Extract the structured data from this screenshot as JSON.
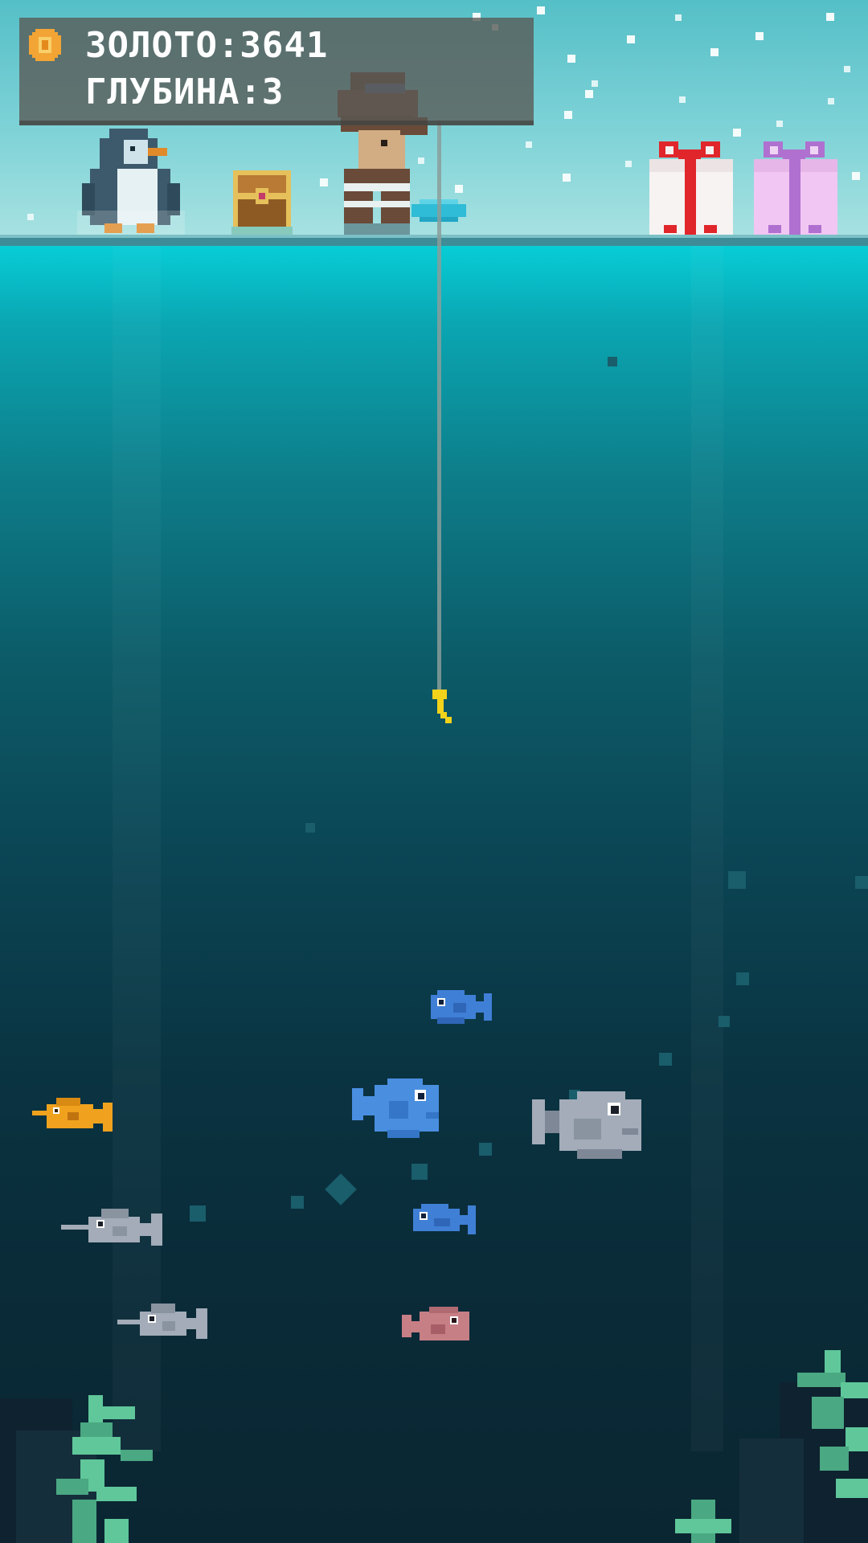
{
  "hud": {
    "gold_text": "ЗОЛОТО:3641",
    "depth_text": "ГЛУБИНА:3"
  },
  "colors": {
    "sky": "#7fd3d7",
    "water_top": "#07cdd6",
    "water_deep": "#0a2632",
    "hud_bg": "#585854",
    "hud_text": "#ffffff",
    "coin": "#f2a534",
    "hook": "#f3d21b",
    "gift_red_ribbon": "#e0262b",
    "gift_purple_ribbon": "#b070d0"
  },
  "scene": {
    "surface_items": [
      "penguin",
      "treasure-chest",
      "fisherman",
      "ice-hole",
      "gift-red",
      "gift-purple"
    ],
    "fish": [
      {
        "kind": "blue-fish",
        "color": "#3f7fd6"
      },
      {
        "kind": "golden-fish",
        "color": "#f0a21e"
      },
      {
        "kind": "big-blue-fish",
        "color": "#4a8ee0"
      },
      {
        "kind": "grey-fish",
        "color": "#a3acb8"
      },
      {
        "kind": "grey-swordfish",
        "color": "#a3acb8"
      },
      {
        "kind": "small-blue-fish",
        "color": "#3f7fd6"
      },
      {
        "kind": "grey-swordfish",
        "color": "#a3acb8"
      },
      {
        "kind": "pink-fish",
        "color": "#c77f86"
      }
    ],
    "seaweed_color": "#5fc79a"
  }
}
